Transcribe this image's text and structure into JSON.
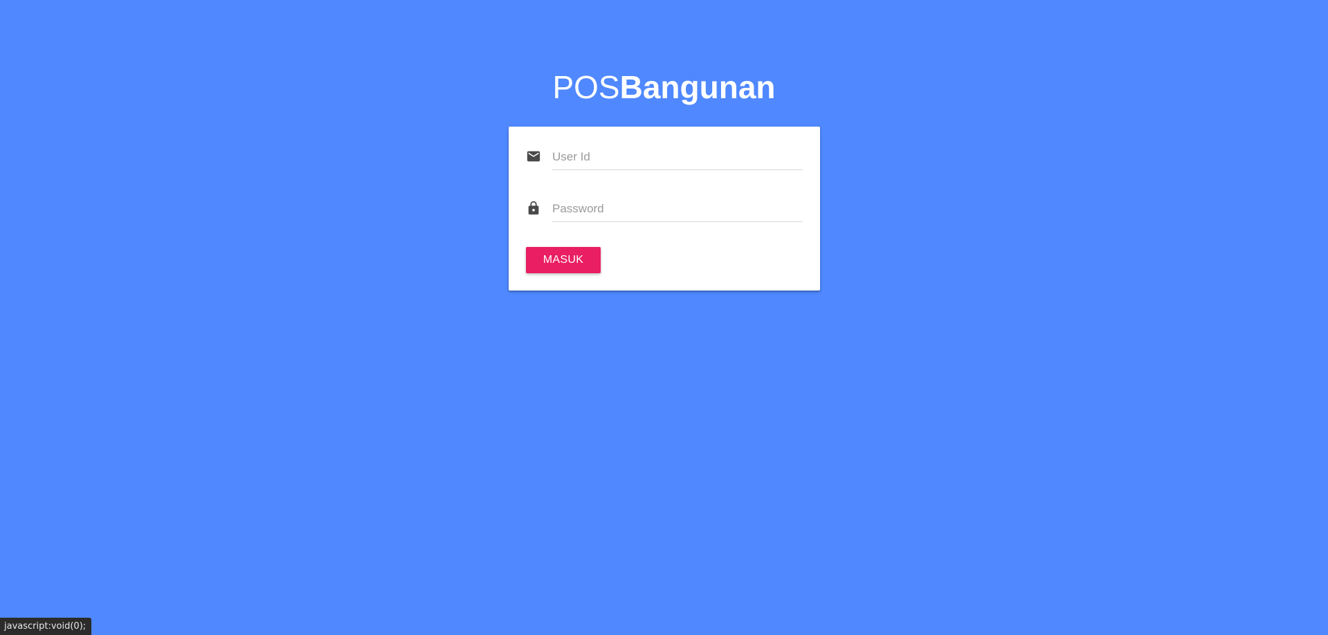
{
  "brand": {
    "light_part": "POS",
    "bold_part": "Bangunan"
  },
  "login_form": {
    "user_id": {
      "placeholder": "User Id",
      "value": "",
      "icon": "email-icon"
    },
    "password": {
      "placeholder": "Password",
      "value": "",
      "icon": "lock-icon"
    },
    "submit_label": "MASUK"
  },
  "status_bar": {
    "text": "javascript:void(0);"
  },
  "colors": {
    "background": "#4f88ff",
    "card": "#ffffff",
    "button": "#e91e63",
    "icon": "#4a4a4a"
  }
}
